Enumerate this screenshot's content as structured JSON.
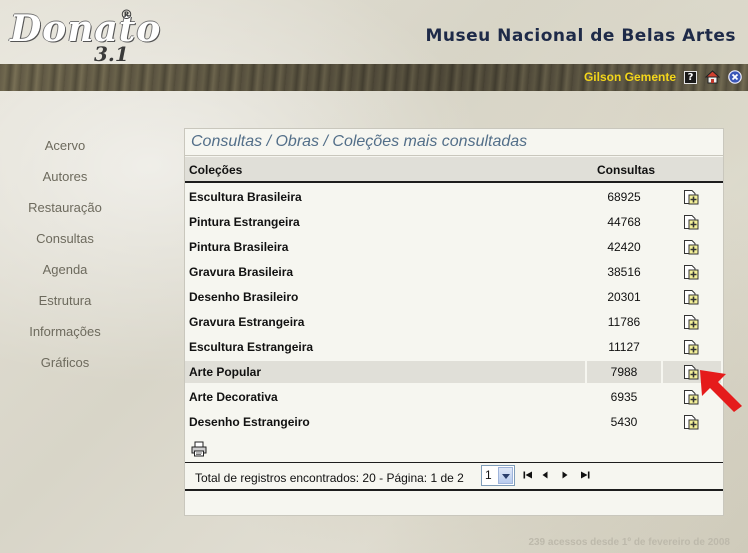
{
  "logo": {
    "text": "Donato",
    "registered": "®",
    "version": "3.1"
  },
  "header": {
    "museum_title": "Museu Nacional de Belas Artes"
  },
  "user": {
    "name": "Gilson Gemente",
    "help_symbol": "?"
  },
  "icons": {
    "help": "help-icon",
    "home": "home-icon",
    "exit": "exit-icon",
    "add": "add-to-collection-icon",
    "print": "printer-icon"
  },
  "colors": {
    "user_name": "#f3d61a",
    "title": "#536f89",
    "museum_title": "#1e2a48",
    "arrow": "#e51b1b",
    "add_icon": "#f4f19a"
  },
  "sidebar": {
    "items": [
      {
        "label": "Acervo"
      },
      {
        "label": "Autores"
      },
      {
        "label": "Restauração"
      },
      {
        "label": "Consultas"
      },
      {
        "label": "Agenda"
      },
      {
        "label": "Estrutura"
      },
      {
        "label": "Informações"
      },
      {
        "label": "Gráficos"
      }
    ]
  },
  "panel": {
    "title": "Consultas / Obras / Coleções mais consultadas",
    "columns": {
      "colecoes": "Coleções",
      "consultas": "Consultas"
    },
    "rows": [
      {
        "name": "Escultura Brasileira",
        "count": "68925"
      },
      {
        "name": "Pintura Estrangeira",
        "count": "44768"
      },
      {
        "name": "Pintura Brasileira",
        "count": "42420"
      },
      {
        "name": "Gravura Brasileira",
        "count": "38516"
      },
      {
        "name": "Desenho Brasileiro",
        "count": "20301"
      },
      {
        "name": "Gravura Estrangeira",
        "count": "11786"
      },
      {
        "name": "Escultura Estrangeira",
        "count": "11127"
      },
      {
        "name": "Arte Popular",
        "count": "7988",
        "highlighted": true
      },
      {
        "name": "Arte Decorativa",
        "count": "6935"
      },
      {
        "name": "Desenho Estrangeiro",
        "count": "5430"
      }
    ],
    "footer": {
      "records_text": "Total de registros encontrados: 20 - Página: 1 de 2",
      "page_selected": "1"
    }
  },
  "access_counter": "239 acessos desde 1º de fevereiro de 2008"
}
